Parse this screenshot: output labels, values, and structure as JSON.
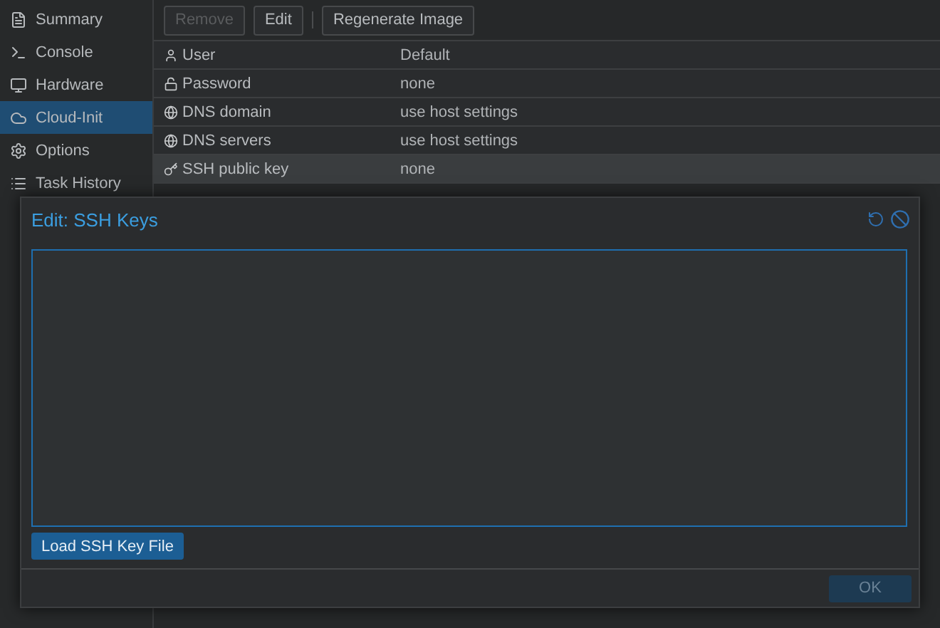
{
  "sidebar": {
    "items": [
      {
        "label": "Summary",
        "kind": "summary",
        "selected": false
      },
      {
        "label": "Console",
        "kind": "console",
        "selected": false
      },
      {
        "label": "Hardware",
        "kind": "hardware",
        "selected": false
      },
      {
        "label": "Cloud-Init",
        "kind": "cloud",
        "selected": true
      },
      {
        "label": "Options",
        "kind": "options",
        "selected": false
      },
      {
        "label": "Task History",
        "kind": "history",
        "selected": false
      }
    ]
  },
  "toolbar": {
    "buttons": [
      {
        "label": "Remove",
        "disabled": true
      },
      {
        "label": "Edit",
        "disabled": false
      },
      {
        "label": "Regenerate Image",
        "disabled": false
      }
    ]
  },
  "table": {
    "rows": [
      {
        "kind": "user",
        "name": "User",
        "value": "Default",
        "selected": false
      },
      {
        "kind": "lock",
        "name": "Password",
        "value": "none",
        "selected": false
      },
      {
        "kind": "globe",
        "name": "DNS domain",
        "value": "use host settings",
        "selected": false
      },
      {
        "kind": "globe",
        "name": "DNS servers",
        "value": "use host settings",
        "selected": false
      },
      {
        "kind": "key",
        "name": "SSH public key",
        "value": "none",
        "selected": true
      }
    ]
  },
  "dialog": {
    "title": "Edit: SSH Keys",
    "load_button": "Load SSH Key File",
    "ok_button": {
      "label": "OK",
      "disabled": true
    }
  }
}
